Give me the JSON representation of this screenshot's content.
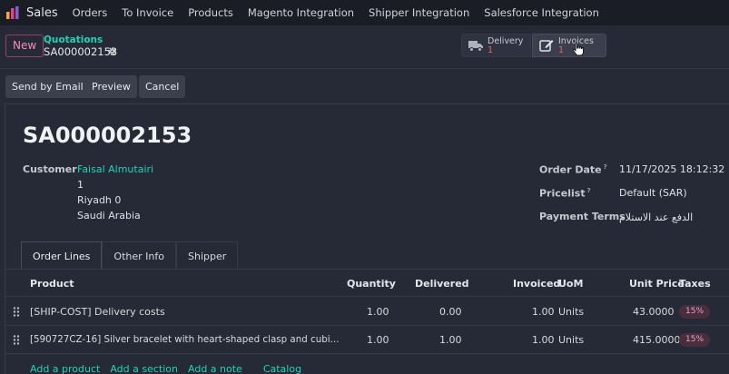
{
  "navbar": {
    "app_name": "Sales",
    "items": [
      "Orders",
      "To Invoice",
      "Products",
      "Magento Integration",
      "Shipper Integration",
      "Salesforce Integration"
    ]
  },
  "control_panel": {
    "new_label": "New",
    "breadcrumb_parent": "Quotations",
    "breadcrumb_current": "SA000002153",
    "smart_buttons": [
      {
        "label": "Delivery",
        "count": "1"
      },
      {
        "label": "Invoices",
        "count": "1"
      }
    ]
  },
  "actions": {
    "send_email": "Send by Email",
    "preview": "Preview",
    "cancel": "Cancel"
  },
  "form": {
    "title": "SA000002153",
    "customer_label": "Customer",
    "customer_name": "Faisal Almutairi",
    "address": [
      "1",
      "Riyadh 0",
      "Saudi Arabia"
    ],
    "order_date_label": "Order Date",
    "order_date": "11/17/2025 18:12:32",
    "pricelist_label": "Pricelist",
    "pricelist": "Default (SAR)",
    "payment_terms_label": "Payment Terms",
    "payment_terms": "الدفع عند الاستلام",
    "help_mark": "?"
  },
  "tabs": [
    "Order Lines",
    "Other Info",
    "Shipper"
  ],
  "table": {
    "headers": {
      "product": "Product",
      "quantity": "Quantity",
      "delivered": "Delivered",
      "invoiced": "Invoiced",
      "uom": "UoM",
      "unit_price": "Unit Price",
      "taxes": "Taxes"
    },
    "rows": [
      {
        "product": "[SHIP-COST] Delivery costs",
        "quantity": "1.00",
        "delivered": "0.00",
        "invoiced": "1.00",
        "uom": "Units",
        "unit_price": "43.0000",
        "tax": "15%"
      },
      {
        "product": "[590727CZ-16] Silver bracelet with heart-shaped clasp and cubi...",
        "quantity": "1.00",
        "delivered": "1.00",
        "invoiced": "1.00",
        "uom": "Units",
        "unit_price": "415.0000",
        "tax": "15%"
      }
    ],
    "add_links": [
      "Add a product",
      "Add a section",
      "Add a note",
      "Catalog"
    ]
  },
  "colors": {
    "accent_teal": "#1ED3B7",
    "new_button_pink": "#F38DBD",
    "count_red": "#E06A5E",
    "tax_badge_bg": "#4A2E3D"
  }
}
